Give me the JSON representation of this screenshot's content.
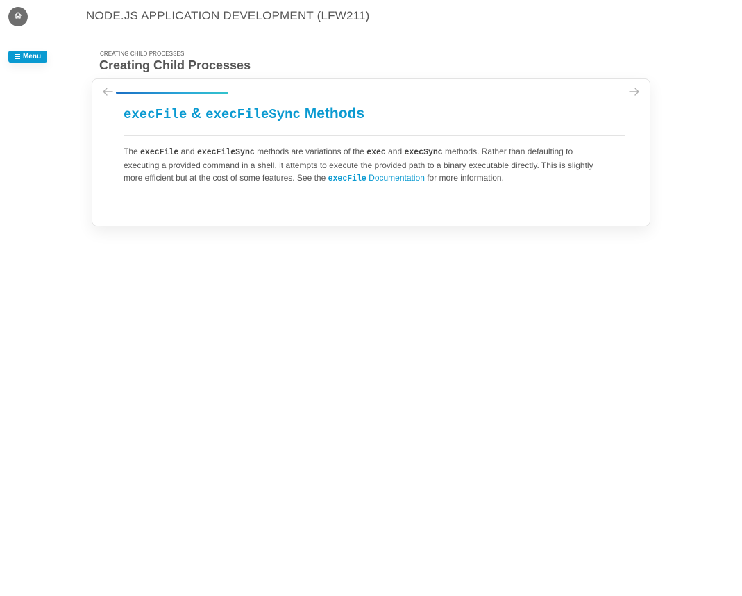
{
  "header": {
    "course_title": "NODE.JS APPLICATION DEVELOPMENT (LFW211)",
    "home_icon": "home-icon"
  },
  "sidebar": {
    "menu_label": "Menu",
    "menu_icon": "hamburger-icon"
  },
  "page": {
    "breadcrumb": "CREATING CHILD PROCESSES",
    "title": "Creating Child Processes"
  },
  "slide": {
    "prev_icon": "arrow-left-icon",
    "next_icon": "arrow-right-icon",
    "progress": 0.22,
    "heading": {
      "code1": "execFile",
      "amp": " & ",
      "code2": "execFileSync",
      "word": " Methods"
    },
    "body": {
      "t1": "The ",
      "c1": "execFile",
      "t2": " and ",
      "c2": "execFileSync",
      "t3": " methods are variations of the ",
      "c3": "exec",
      "t4": " and ",
      "c4": "execSync",
      "t5": " methods. Rather than defaulting to executing a provided command in a shell, it attempts to execute the provided path to a binary executable directly. This is slightly more efficient but at the cost of some features. See the ",
      "link_code": "execFile",
      "link_text": " Documentation",
      "t6": " for more information."
    }
  },
  "colors": {
    "accent": "#0a9ad1",
    "text": "#555555",
    "home_button": "#6e6e6e"
  }
}
